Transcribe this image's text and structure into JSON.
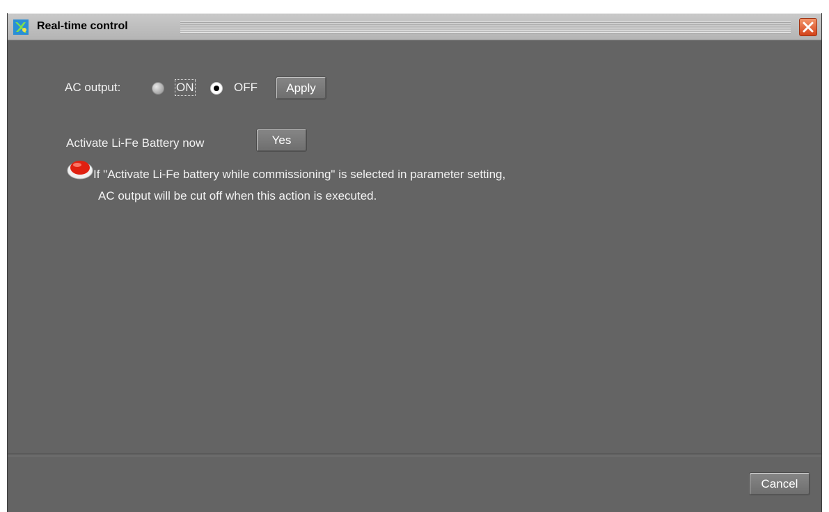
{
  "window": {
    "title": "Real-time control"
  },
  "ac_output": {
    "label": "AC output:",
    "option_on": "ON",
    "option_off": "OFF",
    "selected": "OFF",
    "apply_label": "Apply"
  },
  "battery": {
    "label": "Activate Li-Fe Battery now",
    "yes_label": "Yes",
    "warning_icon": "red-alert-icon",
    "warning_line1": "If \"Activate Li-Fe battery while commissioning\" is selected in parameter setting,",
    "warning_line2": "AC output will be cut off when this action is executed."
  },
  "footer": {
    "cancel_label": "Cancel"
  },
  "icons": {
    "app": "app-logo-icon",
    "close": "close-icon"
  },
  "colors": {
    "panel_bg": "#646464",
    "close_accent": "#e05a2b",
    "warning_red": "#e02010"
  }
}
